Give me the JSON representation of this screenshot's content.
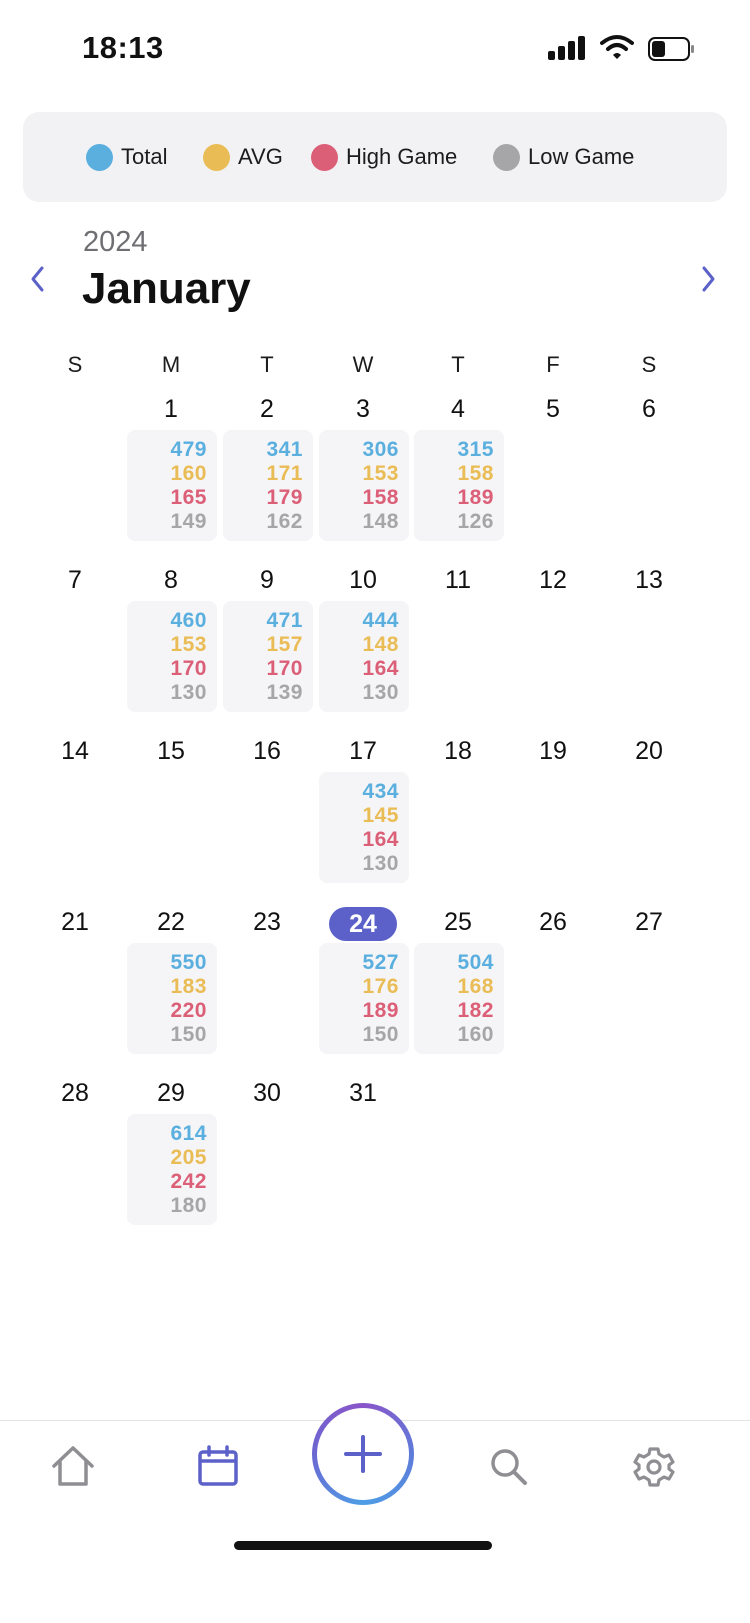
{
  "status_bar": {
    "time": "18:13"
  },
  "legend": {
    "items": [
      {
        "label": "Total",
        "color": "#5aafdf"
      },
      {
        "label": "AVG",
        "color": "#eabc55"
      },
      {
        "label": "High Game",
        "color": "#dc5f78"
      },
      {
        "label": "Low Game",
        "color": "#a6a6a8"
      }
    ]
  },
  "header": {
    "year": "2024",
    "month": "January"
  },
  "weekdays": [
    "S",
    "M",
    "T",
    "W",
    "T",
    "F",
    "S"
  ],
  "today": 24,
  "days": [
    "1",
    "2",
    "3",
    "4",
    "5",
    "6",
    "7",
    "8",
    "9",
    "10",
    "11",
    "12",
    "13",
    "14",
    "15",
    "16",
    "17",
    "18",
    "19",
    "20",
    "21",
    "22",
    "23",
    "24",
    "25",
    "26",
    "27",
    "28",
    "29",
    "30",
    "31"
  ],
  "day_stats": {
    "1": {
      "total": "479",
      "avg": "160",
      "high": "165",
      "low": "149"
    },
    "2": {
      "total": "341",
      "avg": "171",
      "high": "179",
      "low": "162"
    },
    "3": {
      "total": "306",
      "avg": "153",
      "high": "158",
      "low": "148"
    },
    "4": {
      "total": "315",
      "avg": "158",
      "high": "189",
      "low": "126"
    },
    "8": {
      "total": "460",
      "avg": "153",
      "high": "170",
      "low": "130"
    },
    "9": {
      "total": "471",
      "avg": "157",
      "high": "170",
      "low": "139"
    },
    "10": {
      "total": "444",
      "avg": "148",
      "high": "164",
      "low": "130"
    },
    "17": {
      "total": "434",
      "avg": "145",
      "high": "164",
      "low": "130"
    },
    "22": {
      "total": "550",
      "avg": "183",
      "high": "220",
      "low": "150"
    },
    "24": {
      "total": "527",
      "avg": "176",
      "high": "189",
      "low": "150"
    },
    "25": {
      "total": "504",
      "avg": "168",
      "high": "182",
      "low": "160"
    },
    "29": {
      "total": "614",
      "avg": "205",
      "high": "242",
      "low": "180"
    }
  },
  "tab_bar": {
    "icons": [
      "home-icon",
      "calendar-icon",
      "add-icon",
      "search-icon",
      "gear-icon"
    ],
    "active": "calendar-icon",
    "accent": "#5b61c9",
    "inactive": "#8e8e93"
  }
}
